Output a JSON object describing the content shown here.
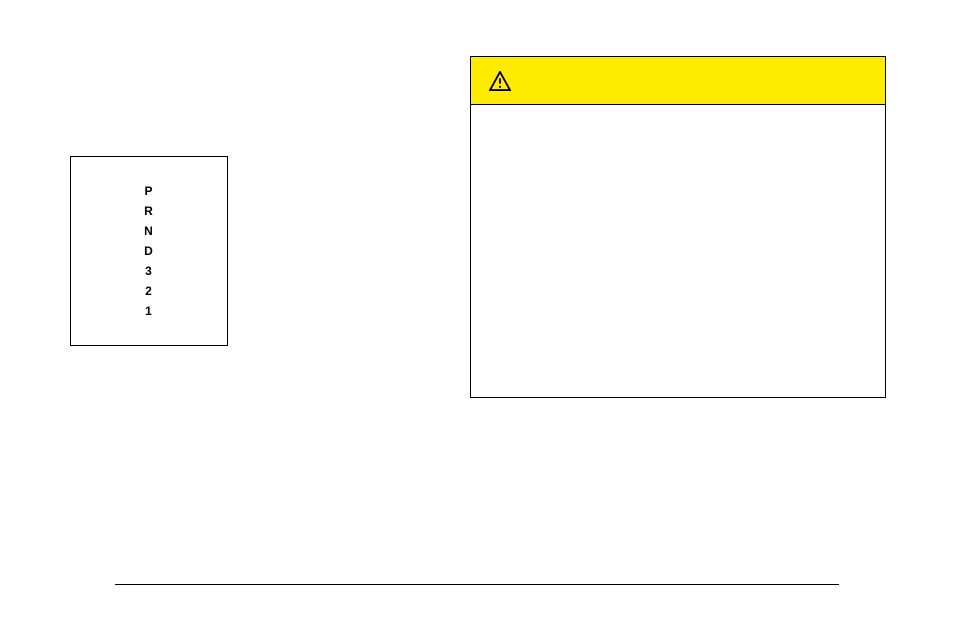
{
  "gear_selector": {
    "positions": [
      "P",
      "R",
      "N",
      "D",
      "3",
      "2",
      "1"
    ]
  },
  "warning_box": {
    "icon_name": "warning-triangle-icon",
    "header_color": "#ffeb00"
  }
}
